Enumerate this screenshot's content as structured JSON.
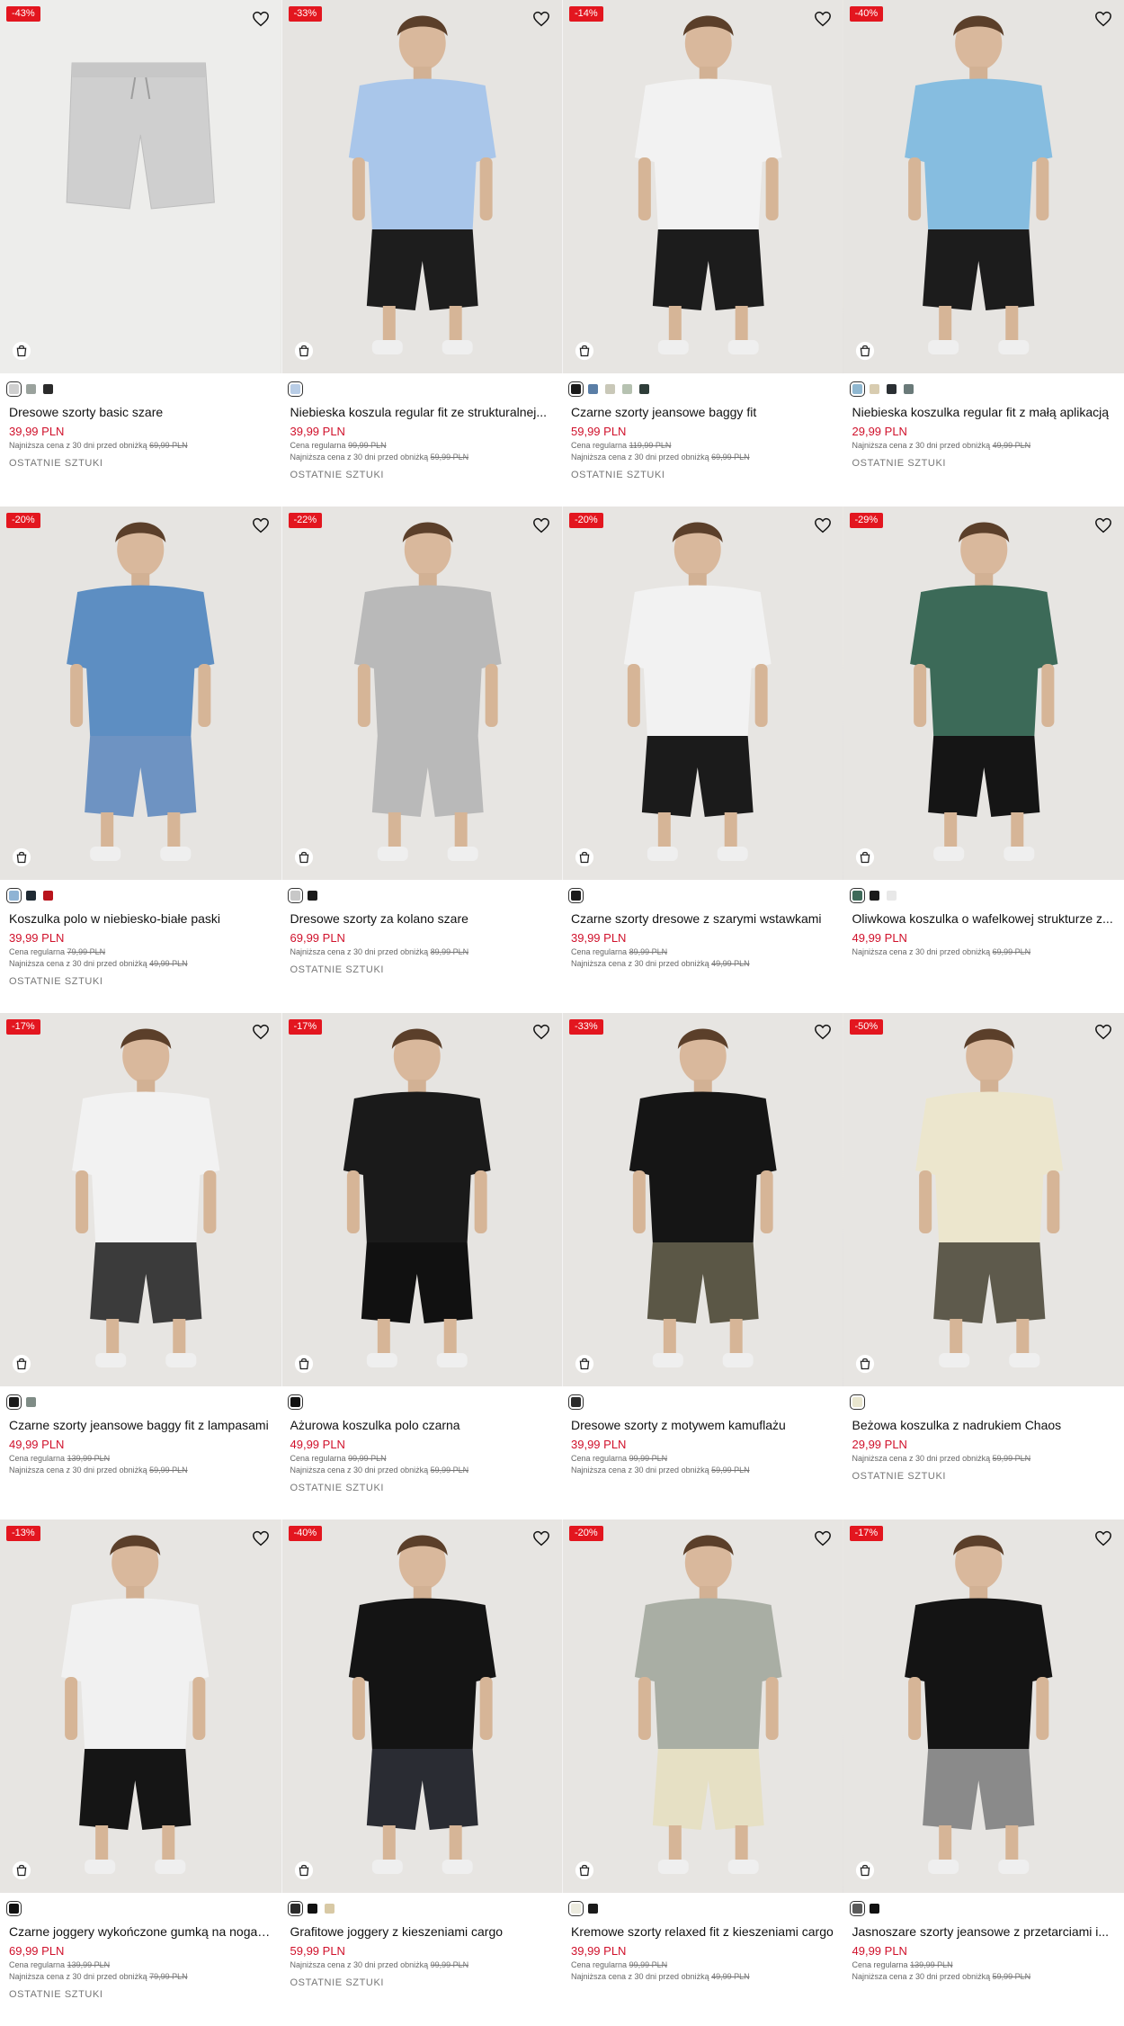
{
  "colors": {
    "sale_red": "#e3161f",
    "price_red": "#d0112b"
  },
  "labels": {
    "regular_prefix": "Cena regularna",
    "lowest_prefix": "Najniższa cena z 30 dni przed obniżką",
    "last_items": "OSTATNIE SZTUKI"
  },
  "products": [
    {
      "discount": "-43%",
      "swatches": [
        "#cfcfcf",
        "#9aa29d",
        "#2b2b2b"
      ],
      "name": "Dresowe szorty basic szare",
      "price": "39,99 PLN",
      "regular": "",
      "lowest": "69,99 PLN",
      "stock": "OSTATNIE SZTUKI",
      "icon": "shorts-image",
      "shirt": "#cfcfcf",
      "pants": "#cfcfcf",
      "bg": "#ededeb"
    },
    {
      "discount": "-33%",
      "swatches": [
        "#b9cde6"
      ],
      "name": "Niebieska koszula regular fit ze strukturalnej...",
      "price": "39,99 PLN",
      "regular": "99,99 PLN",
      "lowest": "59,99 PLN",
      "stock": "OSTATNIE SZTUKI",
      "icon": "model-image",
      "shirt": "#a9c6ea",
      "pants": "#1d1d1d",
      "bg": "#e6e4e1"
    },
    {
      "discount": "-14%",
      "swatches": [
        "#1a1a1a",
        "#5a7ea6",
        "#c9c8b8",
        "#b6c2b1",
        "#2e3d39"
      ],
      "name": "Czarne szorty jeansowe baggy fit",
      "price": "59,99 PLN",
      "regular": "119,99 PLN",
      "lowest": "69,99 PLN",
      "stock": "OSTATNIE SZTUKI",
      "icon": "model-image",
      "shirt": "#f2f2f2",
      "pants": "#1c1c1c",
      "bg": "#e7e5e2"
    },
    {
      "discount": "-40%",
      "swatches": [
        "#8fb7d0",
        "#d8ccb0",
        "#2a2f33",
        "#6a7a79"
      ],
      "name": "Niebieska koszulka regular fit z małą aplikacją",
      "price": "29,99 PLN",
      "regular": "",
      "lowest": "49,99 PLN",
      "stock": "OSTATNIE SZTUKI",
      "icon": "model-image",
      "shirt": "#86bde0",
      "pants": "#1c1c1c",
      "bg": "#e6e4e1"
    },
    {
      "discount": "-20%",
      "swatches": [
        "#8fb3d4",
        "#1f2a33",
        "#b9141c"
      ],
      "name": "Koszulka polo w niebiesko-białe paski",
      "price": "39,99 PLN",
      "regular": "79,99 PLN",
      "lowest": "49,99 PLN",
      "stock": "OSTATNIE SZTUKI",
      "icon": "model-image",
      "shirt": "#5d8ec2",
      "pants": "#6e93c2",
      "bg": "#e6e4e1"
    },
    {
      "discount": "-22%",
      "swatches": [
        "#c8c8c8",
        "#1a1a1a"
      ],
      "name": "Dresowe szorty za kolano szare",
      "price": "69,99 PLN",
      "regular": "",
      "lowest": "89,99 PLN",
      "stock": "OSTATNIE SZTUKI",
      "icon": "model-image",
      "shirt": "#b9b9b9",
      "pants": "#b9b9b9",
      "bg": "#e7e5e2"
    },
    {
      "discount": "-20%",
      "swatches": [
        "#1a1a1a"
      ],
      "name": "Czarne szorty dresowe z szarymi wstawkami",
      "price": "39,99 PLN",
      "regular": "89,99 PLN",
      "lowest": "49,99 PLN",
      "stock": "",
      "icon": "model-image",
      "shirt": "#f2f2f2",
      "pants": "#1b1b1b",
      "bg": "#e7e5e2"
    },
    {
      "discount": "-29%",
      "swatches": [
        "#3f6b5a",
        "#1a1a1a",
        "#e8e8e8"
      ],
      "name": "Oliwkowa koszulka o wafelkowej strukturze z...",
      "price": "49,99 PLN",
      "regular": "",
      "lowest": "69,99 PLN",
      "stock": "",
      "icon": "model-image",
      "shirt": "#3c6a58",
      "pants": "#151515",
      "bg": "#e7e5e2"
    },
    {
      "discount": "-17%",
      "swatches": [
        "#1a1a1a",
        "#7f8c86"
      ],
      "name": "Czarne szorty jeansowe baggy fit z lampasami",
      "price": "49,99 PLN",
      "regular": "139,99 PLN",
      "lowest": "59,99 PLN",
      "stock": "",
      "icon": "model-image",
      "shirt": "#f2f2f2",
      "pants": "#3b3b3b",
      "bg": "#e7e5e2"
    },
    {
      "discount": "-17%",
      "swatches": [
        "#111111"
      ],
      "name": "Ażurowa koszulka polo czarna",
      "price": "49,99 PLN",
      "regular": "99,99 PLN",
      "lowest": "59,99 PLN",
      "stock": "OSTATNIE SZTUKI",
      "icon": "model-image",
      "shirt": "#1a1a1a",
      "pants": "#111111",
      "bg": "#e6e4e1"
    },
    {
      "discount": "-33%",
      "swatches": [
        "#2b2b2b"
      ],
      "name": "Dresowe szorty z motywem kamuflażu",
      "price": "39,99 PLN",
      "regular": "99,99 PLN",
      "lowest": "59,99 PLN",
      "stock": "",
      "icon": "model-image",
      "shirt": "#151515",
      "pants": "#5b5746",
      "bg": "#e7e5e2"
    },
    {
      "discount": "-50%",
      "swatches": [
        "#e9e6cf"
      ],
      "name": "Beżowa koszulka z nadrukiem Chaos",
      "price": "29,99 PLN",
      "regular": "",
      "lowest": "59,99 PLN",
      "stock": "OSTATNIE SZTUKI",
      "icon": "model-image",
      "shirt": "#ece6cd",
      "pants": "#5e5a4c",
      "bg": "#e7e5e2"
    },
    {
      "discount": "-13%",
      "swatches": [
        "#111111"
      ],
      "name": "Czarne joggery wykończone gumką na nogawce",
      "price": "69,99 PLN",
      "regular": "139,99 PLN",
      "lowest": "79,99 PLN",
      "stock": "OSTATNIE SZTUKI",
      "icon": "model-image",
      "shirt": "#f1f1f1",
      "pants": "#151515",
      "bg": "#e7e5e2"
    },
    {
      "discount": "-40%",
      "swatches": [
        "#2b2b2b",
        "#111111",
        "#d8c9a5"
      ],
      "name": "Grafitowe joggery z kieszeniami cargo",
      "price": "59,99 PLN",
      "regular": "",
      "lowest": "99,99 PLN",
      "stock": "OSTATNIE SZTUKI",
      "icon": "model-image",
      "shirt": "#141414",
      "pants": "#2a2c33",
      "bg": "#e7e5e2"
    },
    {
      "discount": "-20%",
      "swatches": [
        "#ecebdf",
        "#1a1a1a"
      ],
      "name": "Kremowe szorty relaxed fit z kieszeniami cargo",
      "price": "39,99 PLN",
      "regular": "99,99 PLN",
      "lowest": "49,99 PLN",
      "stock": "",
      "icon": "model-image",
      "shirt": "#a9aea4",
      "pants": "#e6e0c4",
      "bg": "#e7e5e2"
    },
    {
      "discount": "-17%",
      "swatches": [
        "#5a5a5a",
        "#111111"
      ],
      "name": "Jasnoszare szorty jeansowe z przetarciami i...",
      "price": "49,99 PLN",
      "regular": "139,99 PLN",
      "lowest": "59,99 PLN",
      "stock": "",
      "icon": "model-image",
      "shirt": "#141414",
      "pants": "#8a8a8a",
      "bg": "#e7e5e2"
    }
  ]
}
